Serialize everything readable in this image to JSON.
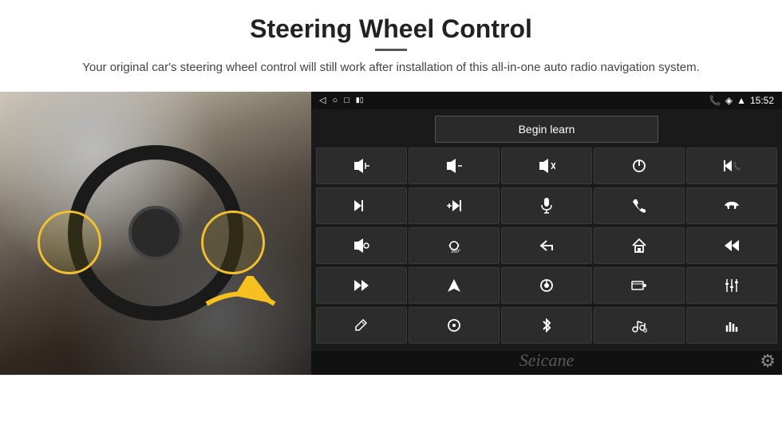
{
  "header": {
    "title": "Steering Wheel Control",
    "subtitle": "Your original car's steering wheel control will still work after installation of this all-in-one auto radio navigation system."
  },
  "android": {
    "statusbar": {
      "back_icon": "◁",
      "home_icon": "○",
      "recent_icon": "□",
      "battery_icon": "▮▯",
      "phone_icon": "📞",
      "location_icon": "◈",
      "wifi_icon": "▲",
      "time": "15:52"
    },
    "begin_learn_label": "Begin learn",
    "buttons": [
      {
        "icon": "🔊+",
        "label": "vol-up"
      },
      {
        "icon": "🔊−",
        "label": "vol-down"
      },
      {
        "icon": "🔇",
        "label": "mute"
      },
      {
        "icon": "⏻",
        "label": "power"
      },
      {
        "icon": "⏮",
        "label": "prev-track-phone"
      },
      {
        "icon": "⏭",
        "label": "next"
      },
      {
        "icon": "⏭×",
        "label": "fast-forward"
      },
      {
        "icon": "🎤",
        "label": "mic"
      },
      {
        "icon": "📞",
        "label": "call"
      },
      {
        "icon": "↩",
        "label": "hang-up"
      },
      {
        "icon": "🔈",
        "label": "speaker"
      },
      {
        "icon": "360°",
        "label": "camera-360"
      },
      {
        "icon": "↶",
        "label": "back"
      },
      {
        "icon": "⌂",
        "label": "home"
      },
      {
        "icon": "⏮⏮",
        "label": "rewind"
      },
      {
        "icon": "⏭⏭",
        "label": "next-track"
      },
      {
        "icon": "▲",
        "label": "navigation"
      },
      {
        "icon": "⏏",
        "label": "eject"
      },
      {
        "icon": "📻",
        "label": "radio"
      },
      {
        "icon": "⚙",
        "label": "settings-eq"
      },
      {
        "icon": "✏",
        "label": "write"
      },
      {
        "icon": "⊙",
        "label": "menu"
      },
      {
        "icon": "✱",
        "label": "bluetooth"
      },
      {
        "icon": "♪⚙",
        "label": "music-settings"
      },
      {
        "icon": "📊",
        "label": "equalizer"
      }
    ],
    "watermark": "Seicane"
  }
}
